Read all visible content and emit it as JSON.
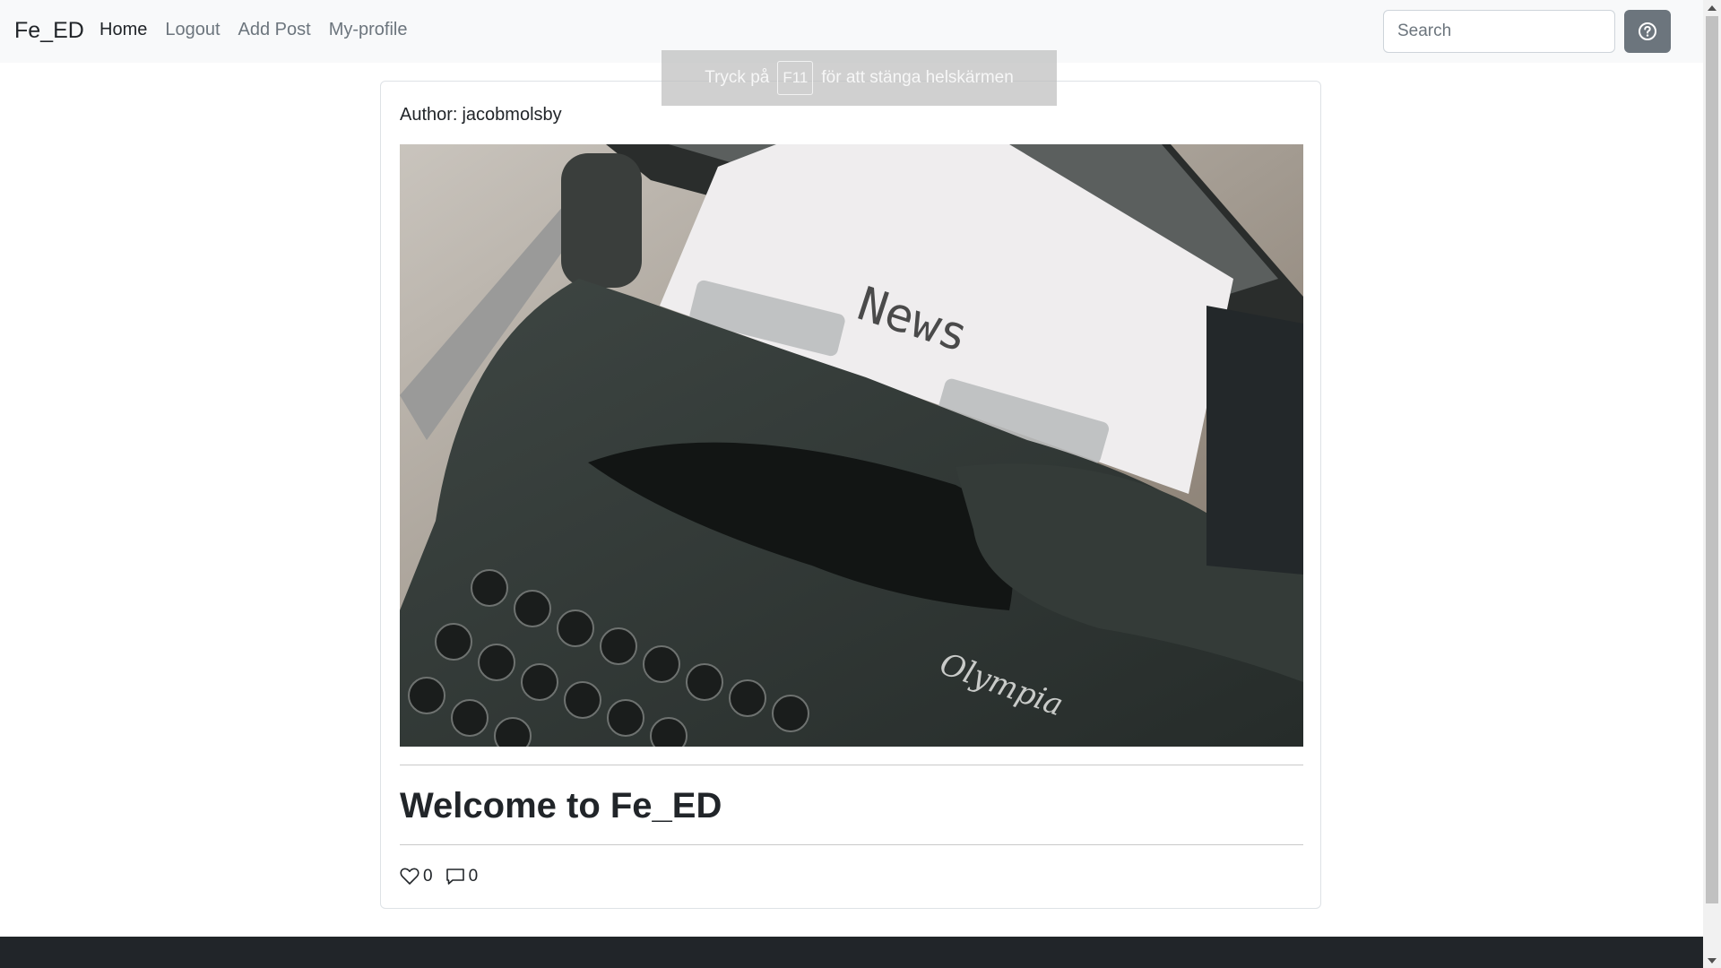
{
  "navbar": {
    "brand": "Fe_ED",
    "links": [
      {
        "label": "Home",
        "active": true
      },
      {
        "label": "Logout",
        "active": false
      },
      {
        "label": "Add Post",
        "active": false
      },
      {
        "label": "My-profile",
        "active": false
      }
    ],
    "search": {
      "placeholder": "Search",
      "value": ""
    },
    "help_icon": "question-circle-icon"
  },
  "toast": {
    "before": "Tryck på",
    "key": "F11",
    "after": "för att stänga helskärmen"
  },
  "post": {
    "author_label": "Author:",
    "author": "jacobmolsby",
    "image": {
      "description": "vintage typewriter",
      "paper_text": "News",
      "brand_text": "Olympia"
    },
    "title": "Welcome to Fe_ED",
    "likes": "0",
    "comments": "0"
  },
  "colors": {
    "navbar_bg": "#f8f9fa",
    "help_button": "#6c757d",
    "footer": "#212529"
  }
}
